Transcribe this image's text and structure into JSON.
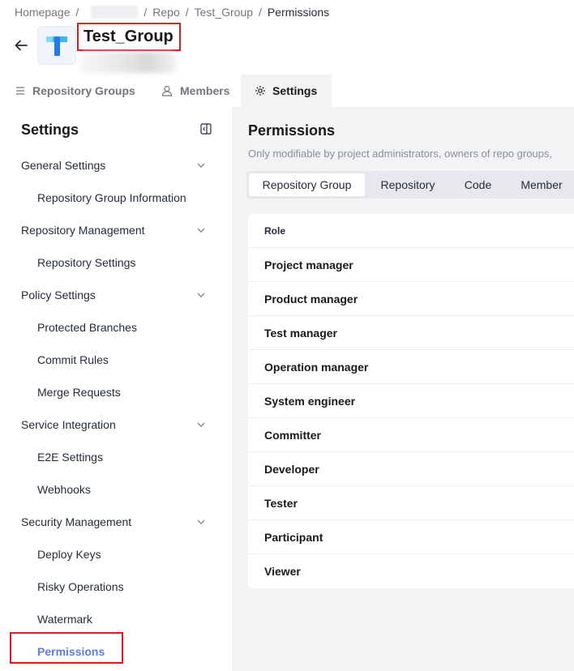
{
  "breadcrumb": {
    "home": "Homepage",
    "repo": "Repo",
    "group": "Test_Group",
    "current": "Permissions"
  },
  "header": {
    "title": "Test_Group"
  },
  "tabs": [
    {
      "label": "Repository Groups",
      "icon": "list-icon"
    },
    {
      "label": "Members",
      "icon": "user-icon"
    },
    {
      "label": "Settings",
      "icon": "gear-icon"
    }
  ],
  "sidebar": {
    "title": "Settings",
    "items": [
      {
        "label": "General Settings",
        "type": "group"
      },
      {
        "label": "Repository Group Information",
        "type": "sub"
      },
      {
        "label": "Repository Management",
        "type": "group"
      },
      {
        "label": "Repository Settings",
        "type": "sub"
      },
      {
        "label": "Policy Settings",
        "type": "group"
      },
      {
        "label": "Protected Branches",
        "type": "sub"
      },
      {
        "label": "Commit Rules",
        "type": "sub"
      },
      {
        "label": "Merge Requests",
        "type": "sub"
      },
      {
        "label": "Service Integration",
        "type": "group"
      },
      {
        "label": "E2E Settings",
        "type": "sub"
      },
      {
        "label": "Webhooks",
        "type": "sub"
      },
      {
        "label": "Security Management",
        "type": "group"
      },
      {
        "label": "Deploy Keys",
        "type": "sub"
      },
      {
        "label": "Risky Operations",
        "type": "sub"
      },
      {
        "label": "Watermark",
        "type": "sub"
      },
      {
        "label": "Permissions",
        "type": "sub"
      }
    ]
  },
  "main": {
    "title": "Permissions",
    "description": "Only modifiable by project administrators, owners of repo groups,",
    "segments": [
      "Repository Group",
      "Repository",
      "Code",
      "Member"
    ],
    "table": {
      "header": "Role",
      "rows": [
        "Project manager",
        "Product manager",
        "Test manager",
        "Operation manager",
        "System engineer",
        "Committer",
        "Developer",
        "Tester",
        "Participant",
        "Viewer"
      ]
    }
  },
  "colors": {
    "accent": "#5e7ce0",
    "highlight": "#e01818",
    "main_bg": "#f2f3f5"
  }
}
